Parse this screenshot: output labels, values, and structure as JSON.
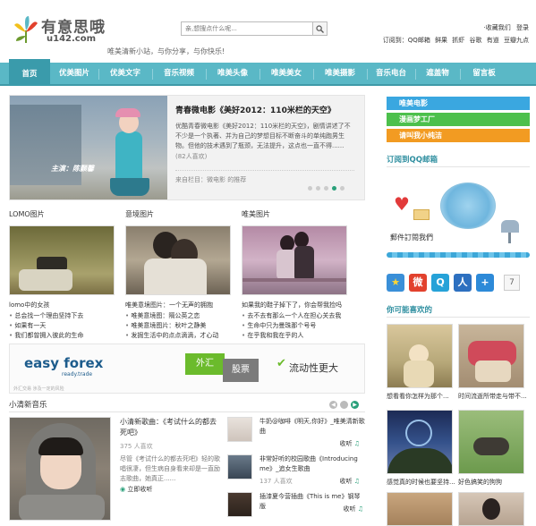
{
  "header": {
    "logo_text": "有意思哦",
    "logo_domain": "u142.com",
    "slogan": "唯美清新小站，与你分享，与你快乐!",
    "search_placeholder": "亲,想搜点什么呢...",
    "top_links": [
      "收藏我们",
      "登录"
    ],
    "subscribe_label": "订阅到：",
    "subscribe_items": [
      "QQ邮箱",
      "鲜果",
      "抓虾",
      "谷歌",
      "有道",
      "豆瓣九点"
    ]
  },
  "nav": {
    "items": [
      "首页",
      "优美图片",
      "优美文字",
      "音乐视频",
      "唯美头像",
      "唯美美女",
      "唯美摄影",
      "音乐电台",
      "遮盖物",
      "留言板"
    ],
    "active_index": 0
  },
  "feature": {
    "image_caption": "主演：陈颢馨",
    "title": "青春微电影《美好2012：110米栏的天空》",
    "description": "优酷青春微电影《美好2012：110米栏的天空》，剧情讲述了不不少是一个执著、并为自己的梦想目标不断奋斗的单纯跑男生物。但他的技术遇到了瓶颈，无法提升，这点也一直不得......",
    "likes": "(82人喜欢)",
    "source": "来自栏目：微电影 的推荐",
    "dots": 5,
    "active_dot": 3
  },
  "columns": [
    {
      "title": "LOMO图片",
      "caption": "lomo中的女孩",
      "items": [
        "总会找一个理由坚持下去",
        "如果有一天",
        "我们都曾拥入彼此的生命"
      ]
    },
    {
      "title": "意境图片",
      "caption": "唯美意境图片：一个无声的拥抱",
      "items": [
        "唯美意境图：隔公英之恋",
        "唯美意境图片：秋叶之静美",
        "发掘生活中的点点滴滴，才心动"
      ]
    },
    {
      "title": "唯美图片",
      "caption": "如果我的鞋子掉下了，你会帮我捡吗",
      "items": [
        "去不去有那么一个人在担心关去我",
        "生命中只为曼珠那个号号",
        "在乎我和我在乎的人"
      ]
    }
  ],
  "ad": {
    "brand_a": "easy",
    "brand_b": "forex",
    "brand_sub": "ready.trade",
    "tag_a": "外汇",
    "tag_b": "股票",
    "slogan": "流动性更大",
    "fine_print": "外汇交易 涉及一定的风险"
  },
  "music": {
    "section_title": "小清新音乐",
    "main_title": "小清新歌曲：《考试什么的都去死吧》",
    "main_likes": "375 人喜欢",
    "main_desc": "尽管《考试什么的都去死吧》轻的歌唱很凄，但生病自身看来却是一直励志歌曲，她真正......",
    "main_action": "立即收听",
    "songs": [
      {
        "title": "牛奶@咖啡《明天,你好》_唯美清新歌曲",
        "likes": "",
        "action": "收听"
      },
      {
        "title": "非常好听的校园歌曲《Introducing me》_追女生歌曲",
        "likes": "137 人喜欢",
        "action": "收听"
      },
      {
        "title": "插漆夏今营插曲《This is me》钢琴版",
        "likes": "",
        "action": "收听"
      }
    ]
  },
  "sidebar": {
    "bars": [
      {
        "label": "唯美电影",
        "color": "#3aa7e0"
      },
      {
        "label": "漫画梦工厂",
        "color": "#4cc04c"
      },
      {
        "label": "请叫我小纯洁",
        "color": "#f29b22"
      }
    ],
    "rss_title": "订阅到QQ邮箱",
    "qq_label": "郵件訂閱我們",
    "social_icons": [
      {
        "name": "qzone-icon",
        "glyph": "★",
        "color": "#3a8fd8"
      },
      {
        "name": "weibo-icon",
        "glyph": "微",
        "color": "#e2412d"
      },
      {
        "name": "tencent-weibo-icon",
        "glyph": "Q",
        "color": "#26a2d8"
      },
      {
        "name": "renren-icon",
        "glyph": "人",
        "color": "#2d70c0"
      },
      {
        "name": "more-share-icon",
        "glyph": "+",
        "color": "#2d8ad8"
      }
    ],
    "share_count": "7",
    "like_title": "你可能喜欢的",
    "like_items": [
      {
        "caption": "想看看你怎样为那个..."
      },
      {
        "caption": "时间流逝所带走与带不..."
      },
      {
        "caption": "感觉真的时候也要坚持..."
      },
      {
        "caption": "好色搞笑的狗狗"
      },
      {
        "caption": ""
      },
      {
        "caption": ""
      }
    ]
  }
}
